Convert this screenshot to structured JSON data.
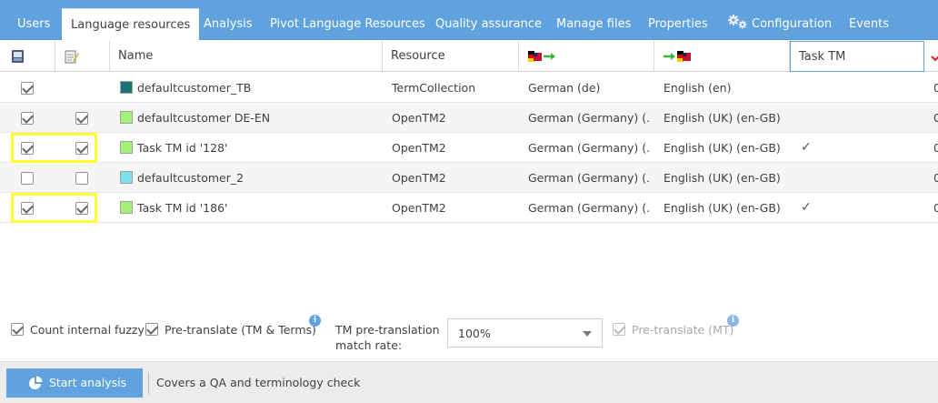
{
  "tabs": [
    {
      "label": "Users"
    },
    {
      "label": "Language resources"
    },
    {
      "label": "Analysis"
    },
    {
      "label": "Pivot Language Resources"
    },
    {
      "label": "Quality assurance"
    },
    {
      "label": "Manage files"
    },
    {
      "label": "Properties"
    },
    {
      "label": "Configuration",
      "icon": "gear-icon"
    },
    {
      "label": "Events"
    }
  ],
  "active_tab": "Language resources",
  "grid": {
    "headers": {
      "col_read": "",
      "col_write": "",
      "name": "Name",
      "resource": "Resource",
      "source_lang": "",
      "target_lang": "",
      "task_tm": "Task TM"
    },
    "header_icons": [
      "read-access-icon",
      "write-access-icon",
      "source-language-flag-icon",
      "target-language-flag-icon",
      "sort-indicator-icon"
    ],
    "rows": [
      {
        "read": true,
        "write": null,
        "name": "defaultcustomer_TB",
        "color": "#1f7373",
        "resource": "TermCollection",
        "source": "German (de)",
        "target": "English (en)",
        "task_tm": false,
        "extra": "0"
      },
      {
        "read": true,
        "write": true,
        "name": "defaultcustomer DE-EN",
        "color": "#a3f07a",
        "resource": "OpenTM2",
        "source": "German (Germany) (...",
        "target": "English (UK) (en-GB)",
        "task_tm": false,
        "extra": "0"
      },
      {
        "read": true,
        "write": true,
        "name": "Task TM id '128'",
        "color": "#a3f07a",
        "resource": "OpenTM2",
        "source": "German (Germany) (...",
        "target": "English (UK) (en-GB)",
        "task_tm": true,
        "extra": "0"
      },
      {
        "read": false,
        "write": false,
        "name": "defaultcustomer_2",
        "color": "#7ee0ee",
        "resource": "OpenTM2",
        "source": "German (Germany) (...",
        "target": "English (UK) (en-GB)",
        "task_tm": false,
        "extra": "0"
      },
      {
        "read": true,
        "write": true,
        "name": "Task TM id '186'",
        "color": "#a3f07a",
        "resource": "OpenTM2",
        "source": "German (Germany) (...",
        "target": "English (UK) (en-GB)",
        "task_tm": true,
        "extra": "0"
      }
    ],
    "tick_glyph": "✓",
    "highlight_color": "#ffff33"
  },
  "options": {
    "count_internal_fuzzy": {
      "label": "Count internal fuzzy",
      "checked": true
    },
    "pretranslate_tm_terms": {
      "label": "Pre-translate (TM & Terms)",
      "checked": true,
      "info": "i"
    },
    "tm_match_rate": {
      "label_line1": "TM pre-translation",
      "label_line2": "match rate:",
      "value": "100%"
    },
    "pretranslate_mt": {
      "label": "Pre-translate (MT)",
      "checked": true,
      "disabled": true,
      "info": "i"
    }
  },
  "toolbar": {
    "start_label": "Start analysis",
    "start_icon": "pie-chart-icon",
    "info_text": "Covers a QA and terminology check"
  },
  "colors": {
    "accent": "#5fa2dd",
    "toolbar_bg": "#ececec"
  }
}
